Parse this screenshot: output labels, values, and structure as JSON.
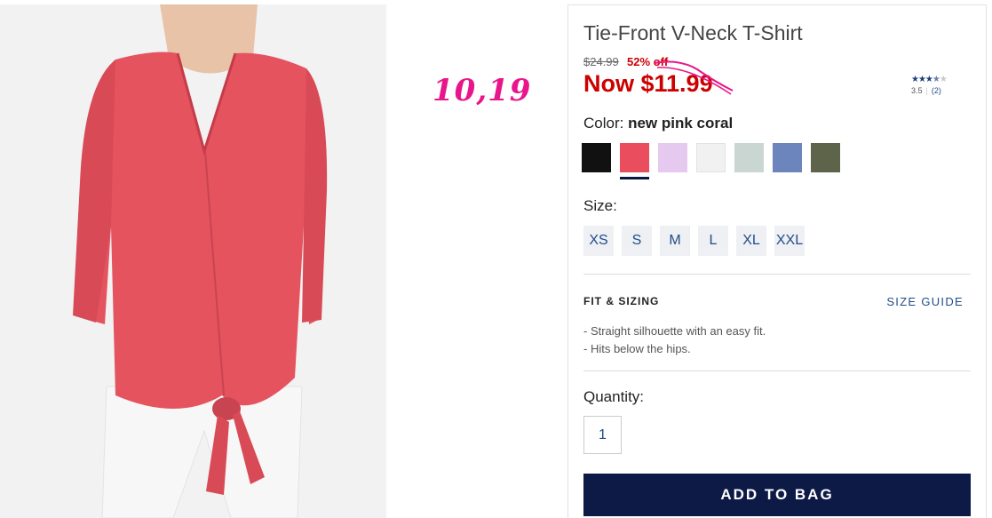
{
  "product": {
    "title": "Tie-Front V-Neck T-Shirt",
    "original_price": "$24.99",
    "discount": "52% off",
    "now_price": "Now $11.99",
    "handwritten_note": "10,19"
  },
  "rating": {
    "stars": "★★★",
    "half_star": "★",
    "empty_star": "★",
    "score": "3.5",
    "count": "(2)"
  },
  "color": {
    "label": "Color:",
    "selected": "new pink coral",
    "swatches": [
      {
        "name": "black",
        "hex": "#111111"
      },
      {
        "name": "new pink coral",
        "hex": "#ea4d5e"
      },
      {
        "name": "lavender",
        "hex": "#e6c9ee"
      },
      {
        "name": "white",
        "hex": "#f1f1f1"
      },
      {
        "name": "sage",
        "hex": "#c9d6d2"
      },
      {
        "name": "blue",
        "hex": "#6c86bd"
      },
      {
        "name": "olive",
        "hex": "#5e6449"
      }
    ]
  },
  "size": {
    "label": "Size:",
    "options": [
      "XS",
      "S",
      "M",
      "L",
      "XL",
      "XXL"
    ]
  },
  "fit": {
    "title": "FIT & SIZING",
    "guide_link": "SIZE GUIDE",
    "bullets": [
      "-  Straight silhouette with an easy fit.",
      "-  Hits below the hips."
    ]
  },
  "quantity": {
    "label": "Quantity:",
    "value": "1"
  },
  "cta": {
    "add_to_bag": "ADD TO BAG"
  }
}
